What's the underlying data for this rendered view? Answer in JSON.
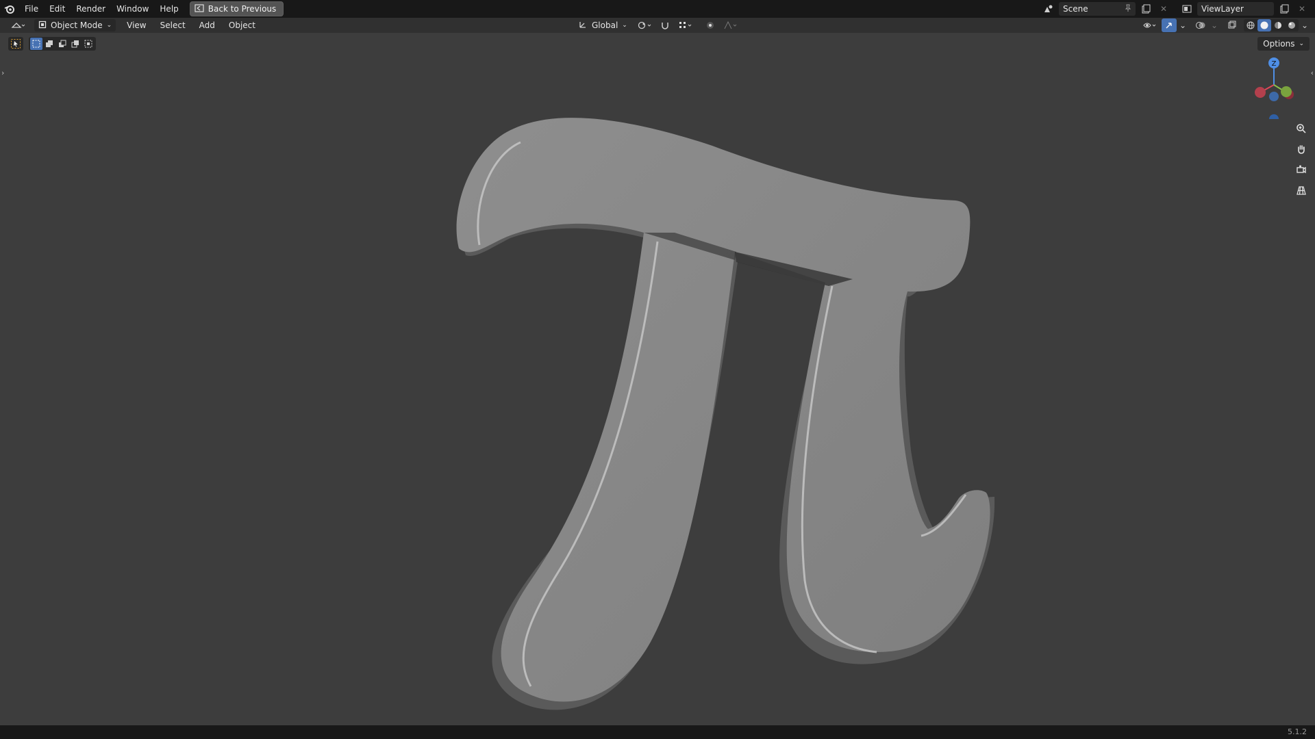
{
  "topbar": {
    "menus": [
      "File",
      "Edit",
      "Render",
      "Window",
      "Help"
    ],
    "back_label": "Back to Previous",
    "scene_name": "Scene",
    "view_layer": "ViewLayer"
  },
  "header": {
    "mode_label": "Object Mode",
    "menus": [
      "View",
      "Select",
      "Add",
      "Object"
    ],
    "transform_orientation": "Global"
  },
  "viewport": {
    "options_label": "Options",
    "gizmo": {
      "z_label": "Z",
      "colors": {
        "x": "#e0485a",
        "y": "#8bc34a",
        "z": "#4f8fe6"
      }
    },
    "object_color": "#8a8a8a"
  },
  "status": {
    "version": "5.1.2"
  },
  "icons": {
    "logo": "blender-logo-icon",
    "editor": "3d-viewport-editor-icon",
    "nav": [
      "zoom-icon",
      "pan-hand-icon",
      "camera-icon",
      "grid-ortho-icon"
    ]
  }
}
